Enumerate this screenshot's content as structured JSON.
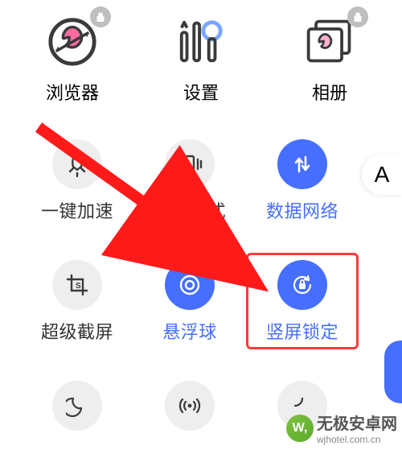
{
  "colors": {
    "accent": "#466eff",
    "highlight": "#ff3a3a",
    "muted": "#eeeeee"
  },
  "apps": {
    "browser": {
      "label": "浏览器",
      "locked": true
    },
    "settings": {
      "label": "设置",
      "locked": false
    },
    "gallery": {
      "label": "相册",
      "locked": true
    }
  },
  "side_letter": "A",
  "qs": {
    "boost": {
      "label": "一键加速",
      "active": false
    },
    "vibrate": {
      "label": "振动模式",
      "active": false
    },
    "data": {
      "label": "数据网络",
      "active": true
    },
    "screenshot": {
      "label": "超级截屏",
      "active": false
    },
    "floatball": {
      "label": "悬浮球",
      "active": true
    },
    "portrait": {
      "label": "竖屏锁定",
      "active": true,
      "highlight": true
    },
    "moon": {
      "label": "",
      "active": false
    },
    "hotspot": {
      "label": "",
      "active": false
    },
    "extra": {
      "label": "",
      "active": false
    }
  },
  "watermark": {
    "logo_text": "W,",
    "title": "无极安卓网",
    "url": "wjhotel.com.cn"
  }
}
